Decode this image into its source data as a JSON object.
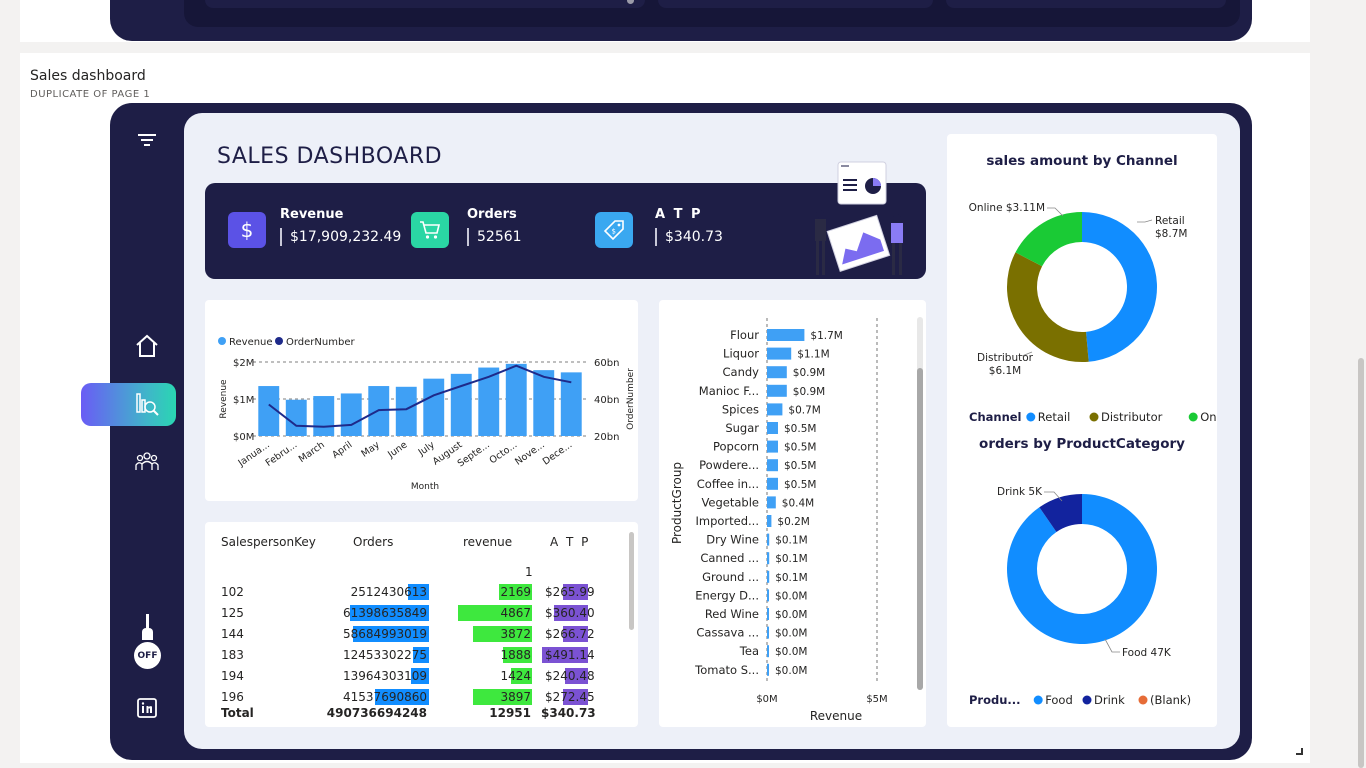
{
  "page": {
    "title": "Sales dashboard",
    "subtitle": "DUPLICATE OF PAGE 1"
  },
  "dashboard": {
    "title": "SALES DASHBOARD",
    "nav": {
      "filter_icon": "filter-icon",
      "home_icon": "home-icon",
      "analytics_icon": "analytics-icon",
      "team_icon": "team-icon",
      "toggle_label": "OFF",
      "linkedin_icon": "linkedin-icon"
    },
    "kpis": [
      {
        "label": "Revenue",
        "value": "$17,909,232.49",
        "icon": "$",
        "color": "#5b52e6"
      },
      {
        "label": "Orders",
        "value": "52561",
        "icon": "cart",
        "color": "#2ad6a4"
      },
      {
        "label": "A T P",
        "value": "$340.73",
        "icon": "tag",
        "color": "#3aa8f0"
      }
    ]
  },
  "combo_chart": {
    "legend": [
      "Revenue",
      "OrderNumber"
    ],
    "y_left_ticks": [
      "$2M",
      "$1M",
      "$0M"
    ],
    "y_right_ticks": [
      "60bn",
      "40bn",
      "20bn"
    ],
    "y_left_label": "Revenue",
    "y_right_label": "OrderNumber",
    "x_label": "Month",
    "months": [
      "Janua...",
      "Febru...",
      "March",
      "April",
      "May",
      "June",
      "July",
      "August",
      "Septe...",
      "Octo...",
      "Nove...",
      "Dece..."
    ]
  },
  "chart_data": [
    {
      "type": "bar",
      "title": "",
      "xlabel": "Month",
      "ylabel": "Revenue",
      "categories": [
        "January",
        "February",
        "March",
        "April",
        "May",
        "June",
        "July",
        "August",
        "September",
        "October",
        "November",
        "December"
      ],
      "series": [
        {
          "name": "Revenue",
          "axis": "left",
          "values": [
            1.35,
            0.98,
            1.08,
            1.15,
            1.35,
            1.33,
            1.55,
            1.68,
            1.85,
            1.95,
            1.78,
            1.72
          ]
        },
        {
          "name": "OrderNumber",
          "axis": "right",
          "type": "line",
          "values": [
            37,
            25.5,
            25,
            26,
            34,
            34.5,
            42,
            47,
            52,
            58,
            52,
            49
          ]
        }
      ],
      "ylim": [
        0,
        2
      ],
      "ylim_right": [
        20,
        60
      ]
    },
    {
      "type": "bar",
      "title": "",
      "xlabel": "Revenue",
      "ylabel": "ProductGroup",
      "orientation": "horizontal",
      "categories": [
        "Flour",
        "Liquor",
        "Candy",
        "Manioc F...",
        "Spices",
        "Sugar",
        "Popcorn",
        "Powdere...",
        "Coffee in...",
        "Vegetable",
        "Imported...",
        "Dry Wine",
        "Canned ...",
        "Ground ...",
        "Energy D...",
        "Red Wine",
        "Cassava ...",
        "Tea",
        "Tomato S..."
      ],
      "values": [
        1.7,
        1.1,
        0.9,
        0.9,
        0.7,
        0.5,
        0.5,
        0.5,
        0.5,
        0.4,
        0.2,
        0.1,
        0.1,
        0.1,
        0.0,
        0.0,
        0.0,
        0.0,
        0.0
      ],
      "data_labels": [
        "$1.7M",
        "$1.1M",
        "$0.9M",
        "$0.9M",
        "$0.7M",
        "$0.5M",
        "$0.5M",
        "$0.5M",
        "$0.5M",
        "$0.4M",
        "$0.2M",
        "$0.1M",
        "$0.1M",
        "$0.1M",
        "$0.0M",
        "$0.0M",
        "$0.0M",
        "$0.0M",
        "$0.0M"
      ],
      "x_ticks": [
        "$0M",
        "$5M"
      ],
      "xlim": [
        0,
        5
      ]
    },
    {
      "type": "pie",
      "title": "sales amount by Channel",
      "donut": true,
      "legend_title": "Channel",
      "categories": [
        "Retail",
        "Distributor",
        "Online"
      ],
      "values": [
        8.7,
        6.1,
        3.11
      ],
      "data_labels": [
        "Retail\n$8.7M",
        "Distributor\n$6.1M",
        "Online $3.11M"
      ],
      "colors": [
        "#118dff",
        "#7a7000",
        "#1aca35"
      ]
    },
    {
      "type": "pie",
      "title": "orders by ProductCategory",
      "donut": true,
      "legend_title": "Produ...",
      "categories": [
        "Food",
        "Drink",
        "(Blank)"
      ],
      "values": [
        47,
        5,
        0
      ],
      "data_labels": [
        "Food 47K",
        "Drink 5K",
        ""
      ],
      "colors": [
        "#118dff",
        "#12239e",
        "#e66c37"
      ]
    }
  ],
  "table": {
    "headers": [
      "SalespersonKey",
      "Orders",
      "revenue",
      "A T P"
    ],
    "filter_row": "1",
    "rows": [
      {
        "key": "102",
        "orders": "2512430613",
        "revenue": "2169",
        "atp": "$265.99",
        "o": 0.26,
        "r": 0.45,
        "a": 0.54
      },
      {
        "key": "125",
        "orders": "61398635849",
        "revenue": "4867",
        "atp": "$360.40",
        "o": 1.0,
        "r": 1.0,
        "a": 0.73
      },
      {
        "key": "144",
        "orders": "58684993019",
        "revenue": "3872",
        "atp": "$266.72",
        "o": 0.96,
        "r": 0.8,
        "a": 0.54
      },
      {
        "key": "183",
        "orders": "12453302275",
        "revenue": "1888",
        "atp": "$491.14",
        "o": 0.2,
        "r": 0.39,
        "a": 1.0
      },
      {
        "key": "194",
        "orders": "13964303109",
        "revenue": "1424",
        "atp": "$240.48",
        "o": 0.23,
        "r": 0.29,
        "a": 0.49
      },
      {
        "key": "196",
        "orders": "41537690860",
        "revenue": "3897",
        "atp": "$272.45",
        "o": 0.68,
        "r": 0.8,
        "a": 0.55
      }
    ],
    "total": {
      "label": "Total",
      "orders": "490736694248",
      "revenue": "12951",
      "atp": "$340.73"
    }
  },
  "colors": {
    "frame": "#1e1e46",
    "accent_blue": "#118dff",
    "table_orders": "#118dff",
    "table_revenue": "#3ee83e",
    "table_atp": "#7b52d3"
  }
}
